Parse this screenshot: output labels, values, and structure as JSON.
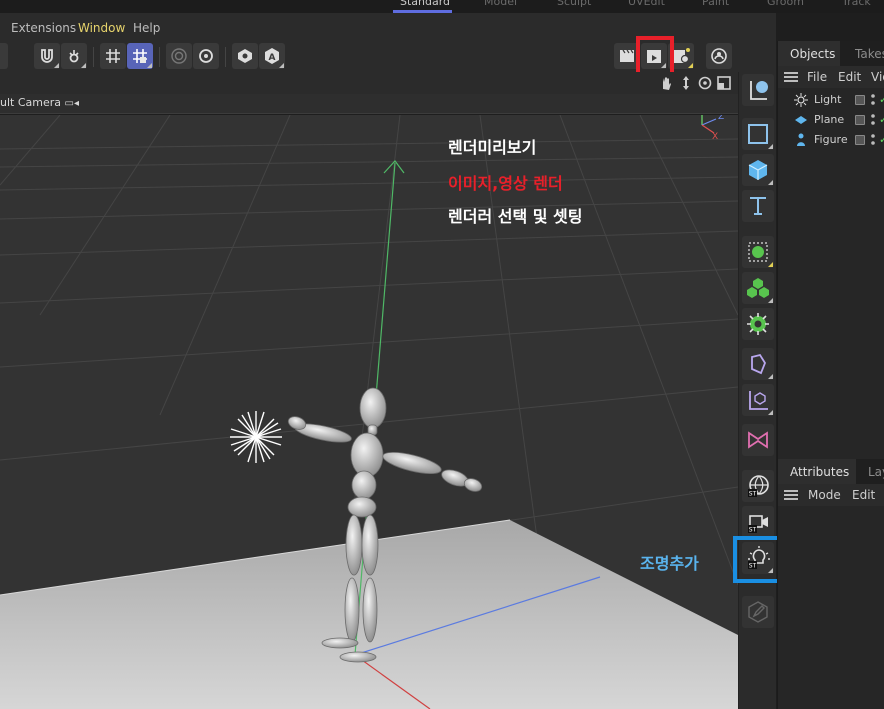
{
  "layout_tabs": [
    {
      "label": "Standard",
      "active": true
    },
    {
      "label": "Model",
      "active": false
    },
    {
      "label": "Sculpt",
      "active": false
    },
    {
      "label": "UVEdit",
      "active": false
    },
    {
      "label": "Paint",
      "active": false
    },
    {
      "label": "Groom",
      "active": false
    },
    {
      "label": "Track",
      "active": false
    }
  ],
  "menu": {
    "extensions": "Extensions",
    "window": "Window",
    "help": "Help"
  },
  "toolbar": {
    "icons": [
      "magnet-icon",
      "gear-snap-icon",
      "grid-icon",
      "grid-active-icon",
      "target-icon",
      "settings-icon",
      "workplane-icon",
      "axis-icon",
      "clapper-icon",
      "render-play-icon",
      "render-settings-icon",
      "picture-viewer-icon"
    ]
  },
  "viewport": {
    "camera_label": "ult Camera",
    "axis": {
      "y": "Y",
      "z": "Z",
      "x": "X"
    }
  },
  "annotations": {
    "render_preview": "렌더미리보기",
    "image_video_render": "이미지,영상 렌더",
    "renderer_settings": "렌더러 선택 및 셋팅",
    "add_light": "조명추가"
  },
  "colors": {
    "highlight_red": "#e8202a",
    "highlight_blue": "#1a8fe3",
    "annotation_white": "#ffffff",
    "annotation_red": "#e8202a",
    "annotation_blue": "#5ab4ee",
    "accent": "#5f6de0",
    "window_menu": "#e6d36c"
  },
  "objects_panel": {
    "tabs": [
      "Objects",
      "Takes"
    ],
    "menu": [
      "File",
      "Edit",
      "Vie"
    ],
    "items": [
      {
        "label": "Light",
        "icon": "light-icon"
      },
      {
        "label": "Plane",
        "icon": "plane-icon"
      },
      {
        "label": "Figure",
        "icon": "figure-icon"
      }
    ]
  },
  "attributes_panel": {
    "tabs": [
      "Attributes",
      "Lay"
    ],
    "menu": [
      "Mode",
      "Edit"
    ]
  }
}
